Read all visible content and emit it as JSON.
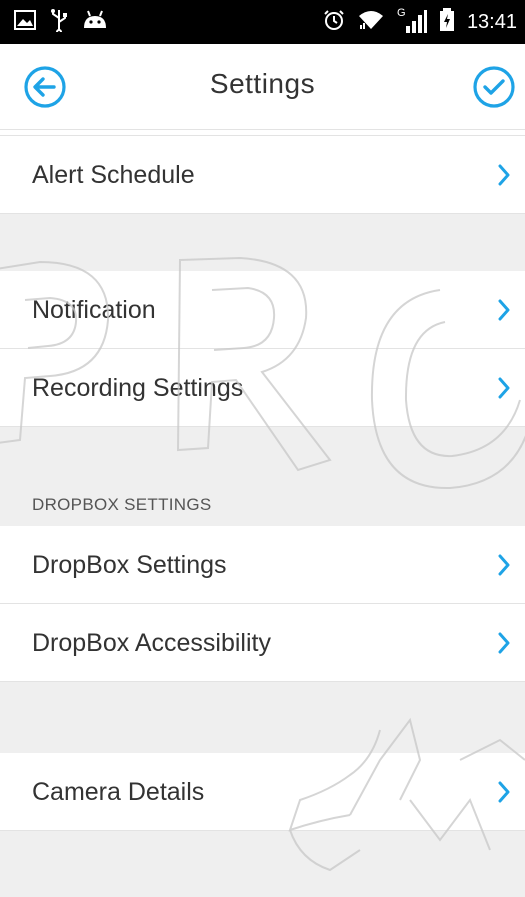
{
  "status_bar": {
    "time": "13:41",
    "network_label": "G",
    "icons": [
      "image-icon",
      "usb-icon",
      "android-icon",
      "alarm-icon",
      "wifi-icon",
      "signal-icon",
      "battery-icon"
    ]
  },
  "header": {
    "title": "Settings",
    "back_icon": "back-arrow-icon",
    "done_icon": "check-circle-icon",
    "accent_color": "#1ea3e6"
  },
  "settings": {
    "alert_schedule": "Alert Schedule",
    "notification": "Notification",
    "recording_settings": "Recording Settings",
    "dropbox_section_header": "DROPBOX SETTINGS",
    "dropbox_settings": "DropBox Settings",
    "dropbox_accessibility": "DropBox Accessibility",
    "camera_details": "Camera Details"
  },
  "watermark": {
    "text": "PRO"
  }
}
